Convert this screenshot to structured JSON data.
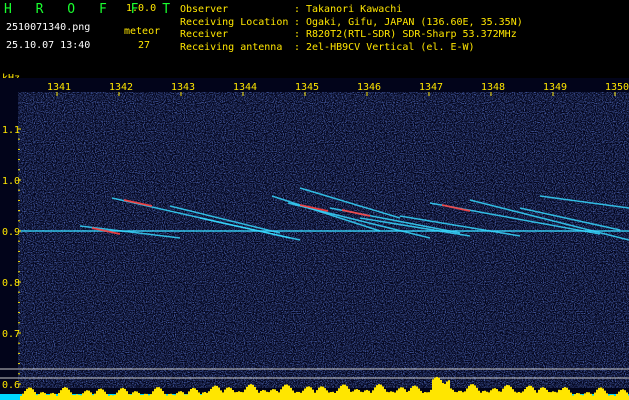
{
  "app": {
    "title": "H R O F F T",
    "version": "1.0.0"
  },
  "file": {
    "name": "2510071340.png",
    "datetime": "25.10.07 13:40"
  },
  "meteor": {
    "label": "meteor",
    "count": "27"
  },
  "info": [
    {
      "key": "Observer",
      "value": "Takanori Kawachi"
    },
    {
      "key": "Receiving Location",
      "value": "Ogaki, Gifu, JAPAN (136.60E, 35.35N)"
    },
    {
      "key": "Receiver",
      "value": "R820T2(RTL-SDR) SDR-Sharp 53.372MHz"
    },
    {
      "key": "Receiving antenna",
      "value": "2el-HB9CV Vertical (el. E-W)"
    }
  ],
  "axis": {
    "unit": "kHz",
    "time_ticks": [
      "1341",
      "1342",
      "1343",
      "1344",
      "1345",
      "1346",
      "1347",
      "1348",
      "1349",
      "1350"
    ],
    "freq_ticks": [
      "1.1",
      "1.0",
      "0.9",
      "0.8",
      "0.7",
      "0.6"
    ]
  },
  "colors": {
    "background": "#000000",
    "title_green": "#19ff2f",
    "label_yellow": "#ffe600",
    "noise_blue": "#1a2d9e",
    "trace_cyan": "#36d8ff",
    "trace_hot": "#ff4040",
    "level_yellow": "#ffe600",
    "level_cyan": "#00d8ff"
  }
}
